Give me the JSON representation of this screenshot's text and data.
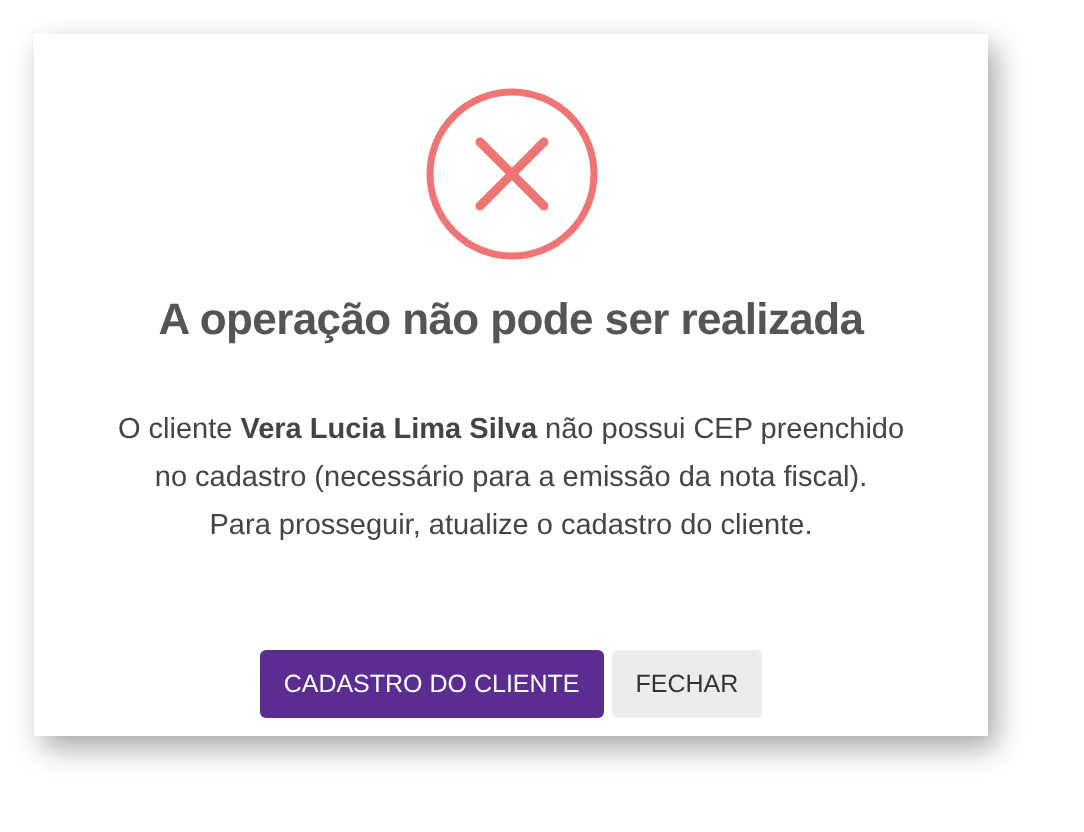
{
  "dialog": {
    "icon": {
      "kind": "error"
    },
    "title": "A operação não pode ser realizada",
    "message": "O cliente **Vera Lucia Lima Silva** não possui CEP preenchido\nno cadastro (necessário para a emissão da nota fiscal).\nPara prosseguir, atualize o cadastro do cliente.",
    "buttons": [
      {
        "label": "CADASTRO DO CLIENTE",
        "kind": "primary"
      },
      {
        "label": "FECHAR",
        "kind": "secondary"
      }
    ]
  }
}
